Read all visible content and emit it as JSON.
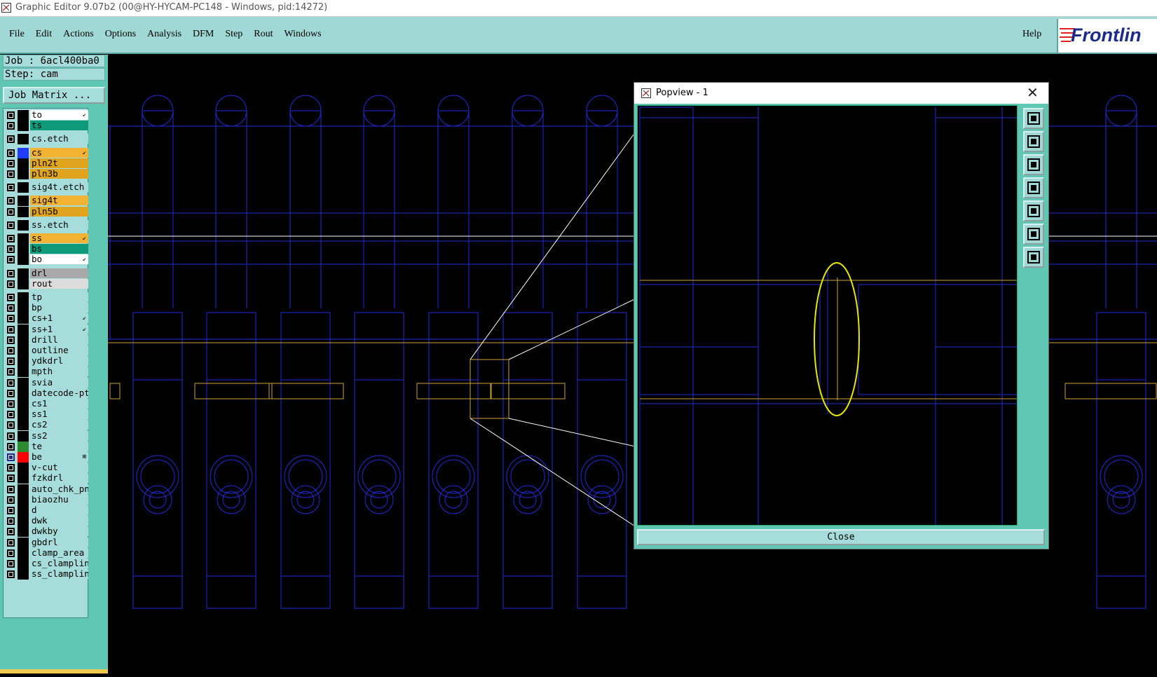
{
  "window": {
    "title": "Graphic Editor 9.07b2 (00@HY-HYCAM-PC148 - Windows, pid:14272)"
  },
  "menu": {
    "items": [
      "File",
      "Edit",
      "Actions",
      "Options",
      "Analysis",
      "DFM",
      "Step",
      "Rout",
      "Windows"
    ],
    "help": "Help"
  },
  "logo": {
    "text": "Frontlin"
  },
  "info": {
    "job": "Job : 6acl400ba0",
    "step": "Step: cam",
    "job_matrix": "Job Matrix ..."
  },
  "layers": [
    {
      "name": "to",
      "bg": "#ffffff",
      "mark": "↙",
      "swatch": "#000000"
    },
    {
      "name": "ts",
      "bg": "#0f9b7a",
      "mark": "",
      "swatch": "#000000"
    },
    {
      "name": "cs.etch",
      "bg": "#a6dcda",
      "mark": "",
      "swatch": "#000000"
    },
    {
      "name": "cs",
      "bg": "#f2b233",
      "mark": "↙",
      "swatch": "#1f3cff"
    },
    {
      "name": "pln2t",
      "bg": "#e0a41f",
      "mark": "",
      "swatch": "#000000"
    },
    {
      "name": "pln3b",
      "bg": "#e0a41f",
      "mark": "",
      "swatch": "#000000"
    },
    {
      "name": "sig4t.etch",
      "bg": "#a6dcda",
      "mark": "",
      "swatch": "#000000"
    },
    {
      "name": "sig4t",
      "bg": "#f2b233",
      "mark": "",
      "swatch": "#000000"
    },
    {
      "name": "pln5b",
      "bg": "#e0a41f",
      "mark": "",
      "swatch": "#000000"
    },
    {
      "name": "ss.etch",
      "bg": "#a6dcda",
      "mark": "",
      "swatch": "#000000"
    },
    {
      "name": "ss",
      "bg": "#f2b233",
      "mark": "↙",
      "swatch": "#000000"
    },
    {
      "name": "bs",
      "bg": "#0f9b7a",
      "mark": "",
      "swatch": "#000000"
    },
    {
      "name": "bo",
      "bg": "#ffffff",
      "mark": "↙",
      "swatch": "#000000"
    },
    {
      "name": "drl",
      "bg": "#a8a8a8",
      "mark": "",
      "swatch": "#000000"
    },
    {
      "name": "rout",
      "bg": "#dcdcdc",
      "mark": "",
      "swatch": "#000000"
    },
    {
      "name": "tp",
      "bg": "#a6dcda",
      "mark": "",
      "swatch": "#000000"
    },
    {
      "name": "bp",
      "bg": "#a6dcda",
      "mark": "",
      "swatch": "#000000"
    },
    {
      "name": "cs+1",
      "bg": "#a6dcda",
      "mark": "↙",
      "swatch": "#000000"
    },
    {
      "name": "ss+1",
      "bg": "#a6dcda",
      "mark": "↙",
      "swatch": "#000000"
    },
    {
      "name": "drill",
      "bg": "#a6dcda",
      "mark": "",
      "swatch": "#000000"
    },
    {
      "name": "outline",
      "bg": "#a6dcda",
      "mark": "",
      "swatch": "#000000"
    },
    {
      "name": "ydkdrl",
      "bg": "#a6dcda",
      "mark": "",
      "swatch": "#000000"
    },
    {
      "name": "mpth",
      "bg": "#a6dcda",
      "mark": "",
      "swatch": "#000000"
    },
    {
      "name": "svia",
      "bg": "#a6dcda",
      "mark": "",
      "swatch": "#000000"
    },
    {
      "name": "datecode-pto",
      "bg": "#a6dcda",
      "mark": "",
      "swatch": "#000000"
    },
    {
      "name": "cs1",
      "bg": "#a6dcda",
      "mark": "",
      "swatch": "#000000"
    },
    {
      "name": "ss1",
      "bg": "#a6dcda",
      "mark": "",
      "swatch": "#000000"
    },
    {
      "name": "cs2",
      "bg": "#a6dcda",
      "mark": "",
      "swatch": "#000000"
    },
    {
      "name": "ss2",
      "bg": "#a6dcda",
      "mark": "",
      "swatch": "#000000"
    },
    {
      "name": "te",
      "bg": "#a6dcda",
      "mark": "",
      "swatch": "#2e8b2e"
    },
    {
      "name": "be",
      "bg": "#a6dcda",
      "mark": "⊞",
      "swatch": "#ff0000"
    },
    {
      "name": "v-cut",
      "bg": "#a6dcda",
      "mark": "",
      "swatch": "#000000"
    },
    {
      "name": "fzkdrl",
      "bg": "#a6dcda",
      "mark": "",
      "swatch": "#000000"
    },
    {
      "name": "auto_chk_pni",
      "bg": "#a6dcda",
      "mark": "",
      "swatch": "#000000"
    },
    {
      "name": "biaozhu",
      "bg": "#a6dcda",
      "mark": "",
      "swatch": "#000000"
    },
    {
      "name": "d",
      "bg": "#a6dcda",
      "mark": "",
      "swatch": "#000000"
    },
    {
      "name": "dwk",
      "bg": "#a6dcda",
      "mark": "",
      "swatch": "#000000"
    },
    {
      "name": "dwkby",
      "bg": "#a6dcda",
      "mark": "",
      "swatch": "#000000"
    },
    {
      "name": "gbdrl",
      "bg": "#a6dcda",
      "mark": "",
      "swatch": "#000000"
    },
    {
      "name": "clamp_area",
      "bg": "#a6dcda",
      "mark": "",
      "swatch": "#000000"
    },
    {
      "name": "cs_clampline",
      "bg": "#a6dcda",
      "mark": "",
      "swatch": "#000000"
    },
    {
      "name": "ss_clampline",
      "bg": "#a6dcda",
      "mark": "",
      "swatch": "#000000"
    }
  ],
  "popview": {
    "title": "Popview - 1",
    "close_label": "Close",
    "close_x": "✕"
  },
  "colors": {
    "blue": "#1e2bd6",
    "yellow": "#e6e600",
    "orange": "#c9a23a",
    "white": "#ffffff"
  },
  "icons": [
    "zoom-fit-icon",
    "pan-up-icon",
    "pan-down-icon",
    "pan-left-icon",
    "pan-right-icon",
    "zoom-out-icon",
    "zoom-in-icon"
  ]
}
